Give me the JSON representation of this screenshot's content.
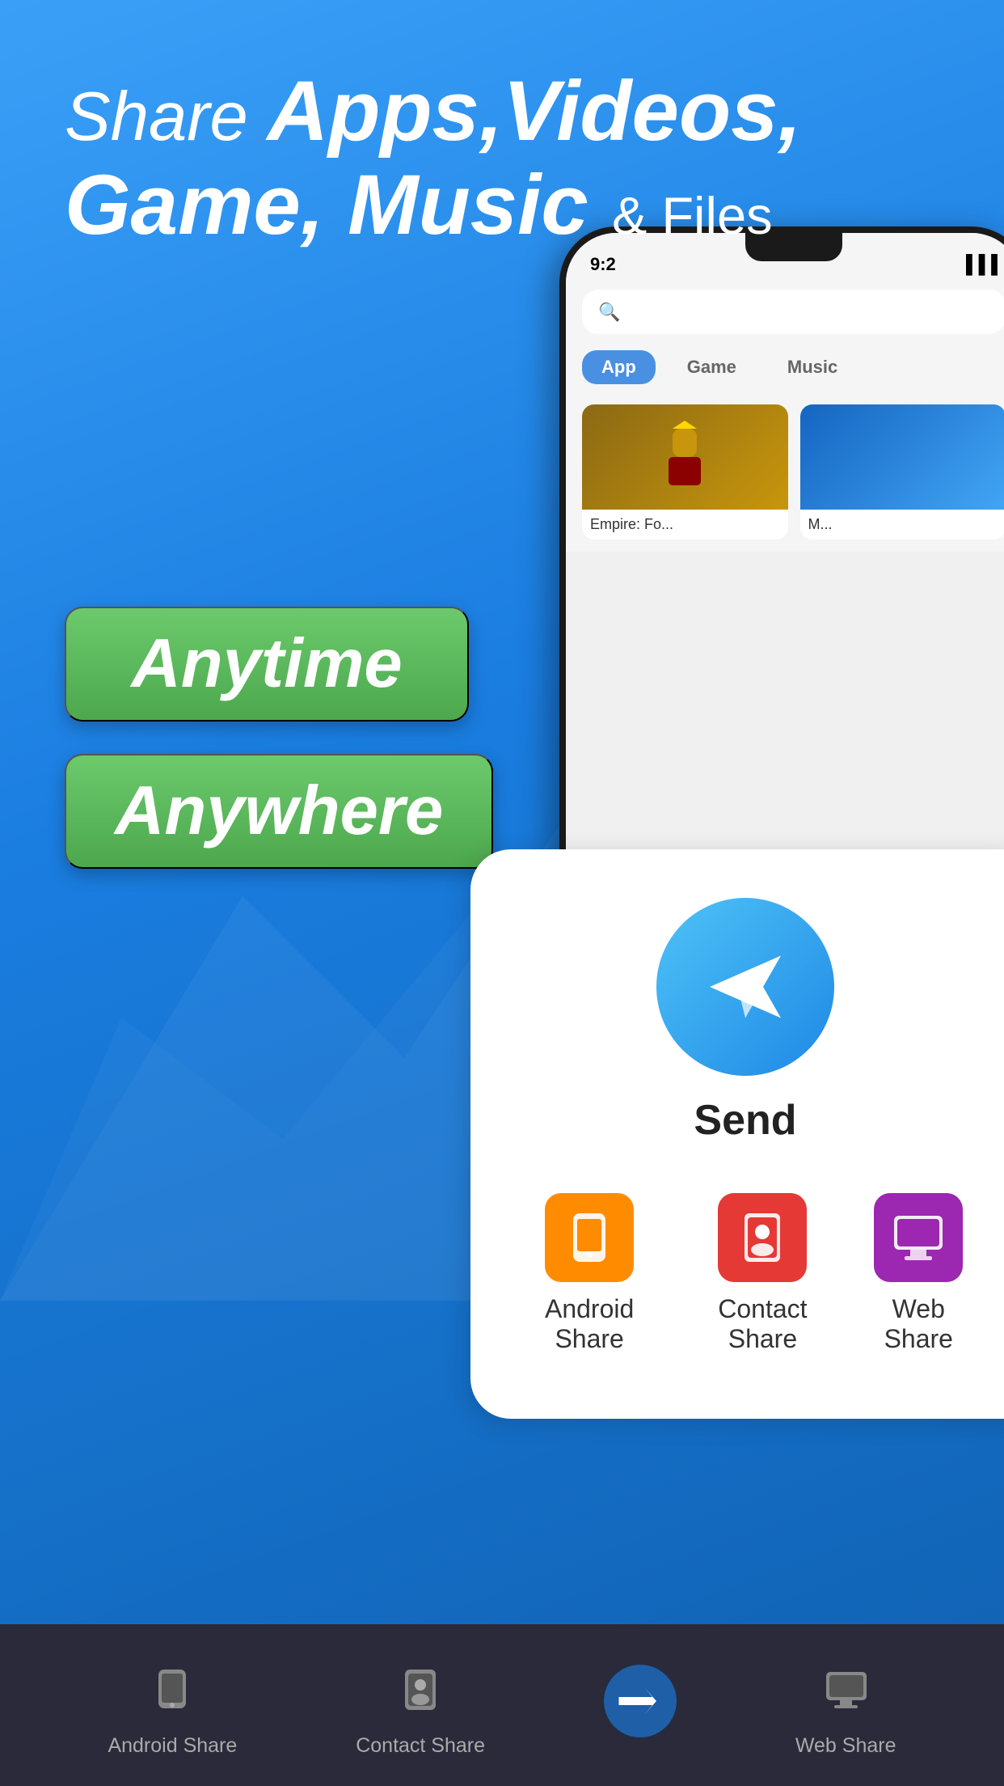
{
  "background": {
    "color": "#2d8fef"
  },
  "header": {
    "line1_prefix": "Share ",
    "line1_bold": "Apps,Videos,",
    "line2": "Game, Music",
    "line3_suffix": "& Files"
  },
  "buttons": {
    "anytime": "Anytime",
    "anywhere": "Anywhere"
  },
  "phone": {
    "time": "9:2",
    "search_placeholder": "🔍",
    "tab_active": "App",
    "app_item": "Empire: Fo..."
  },
  "send_panel": {
    "send_label": "Send",
    "options": [
      {
        "id": "android",
        "label": "Android Share"
      },
      {
        "id": "contact",
        "label": "Contact Share"
      },
      {
        "id": "web",
        "label": "Web Share"
      }
    ]
  },
  "bottom_nav": {
    "items": [
      {
        "id": "android",
        "label": "Android Share",
        "active": false
      },
      {
        "id": "contact",
        "label": "Contact Share",
        "active": false
      },
      {
        "id": "transfer",
        "label": "",
        "active": true
      },
      {
        "id": "web",
        "label": "Web Share",
        "active": false
      }
    ]
  }
}
